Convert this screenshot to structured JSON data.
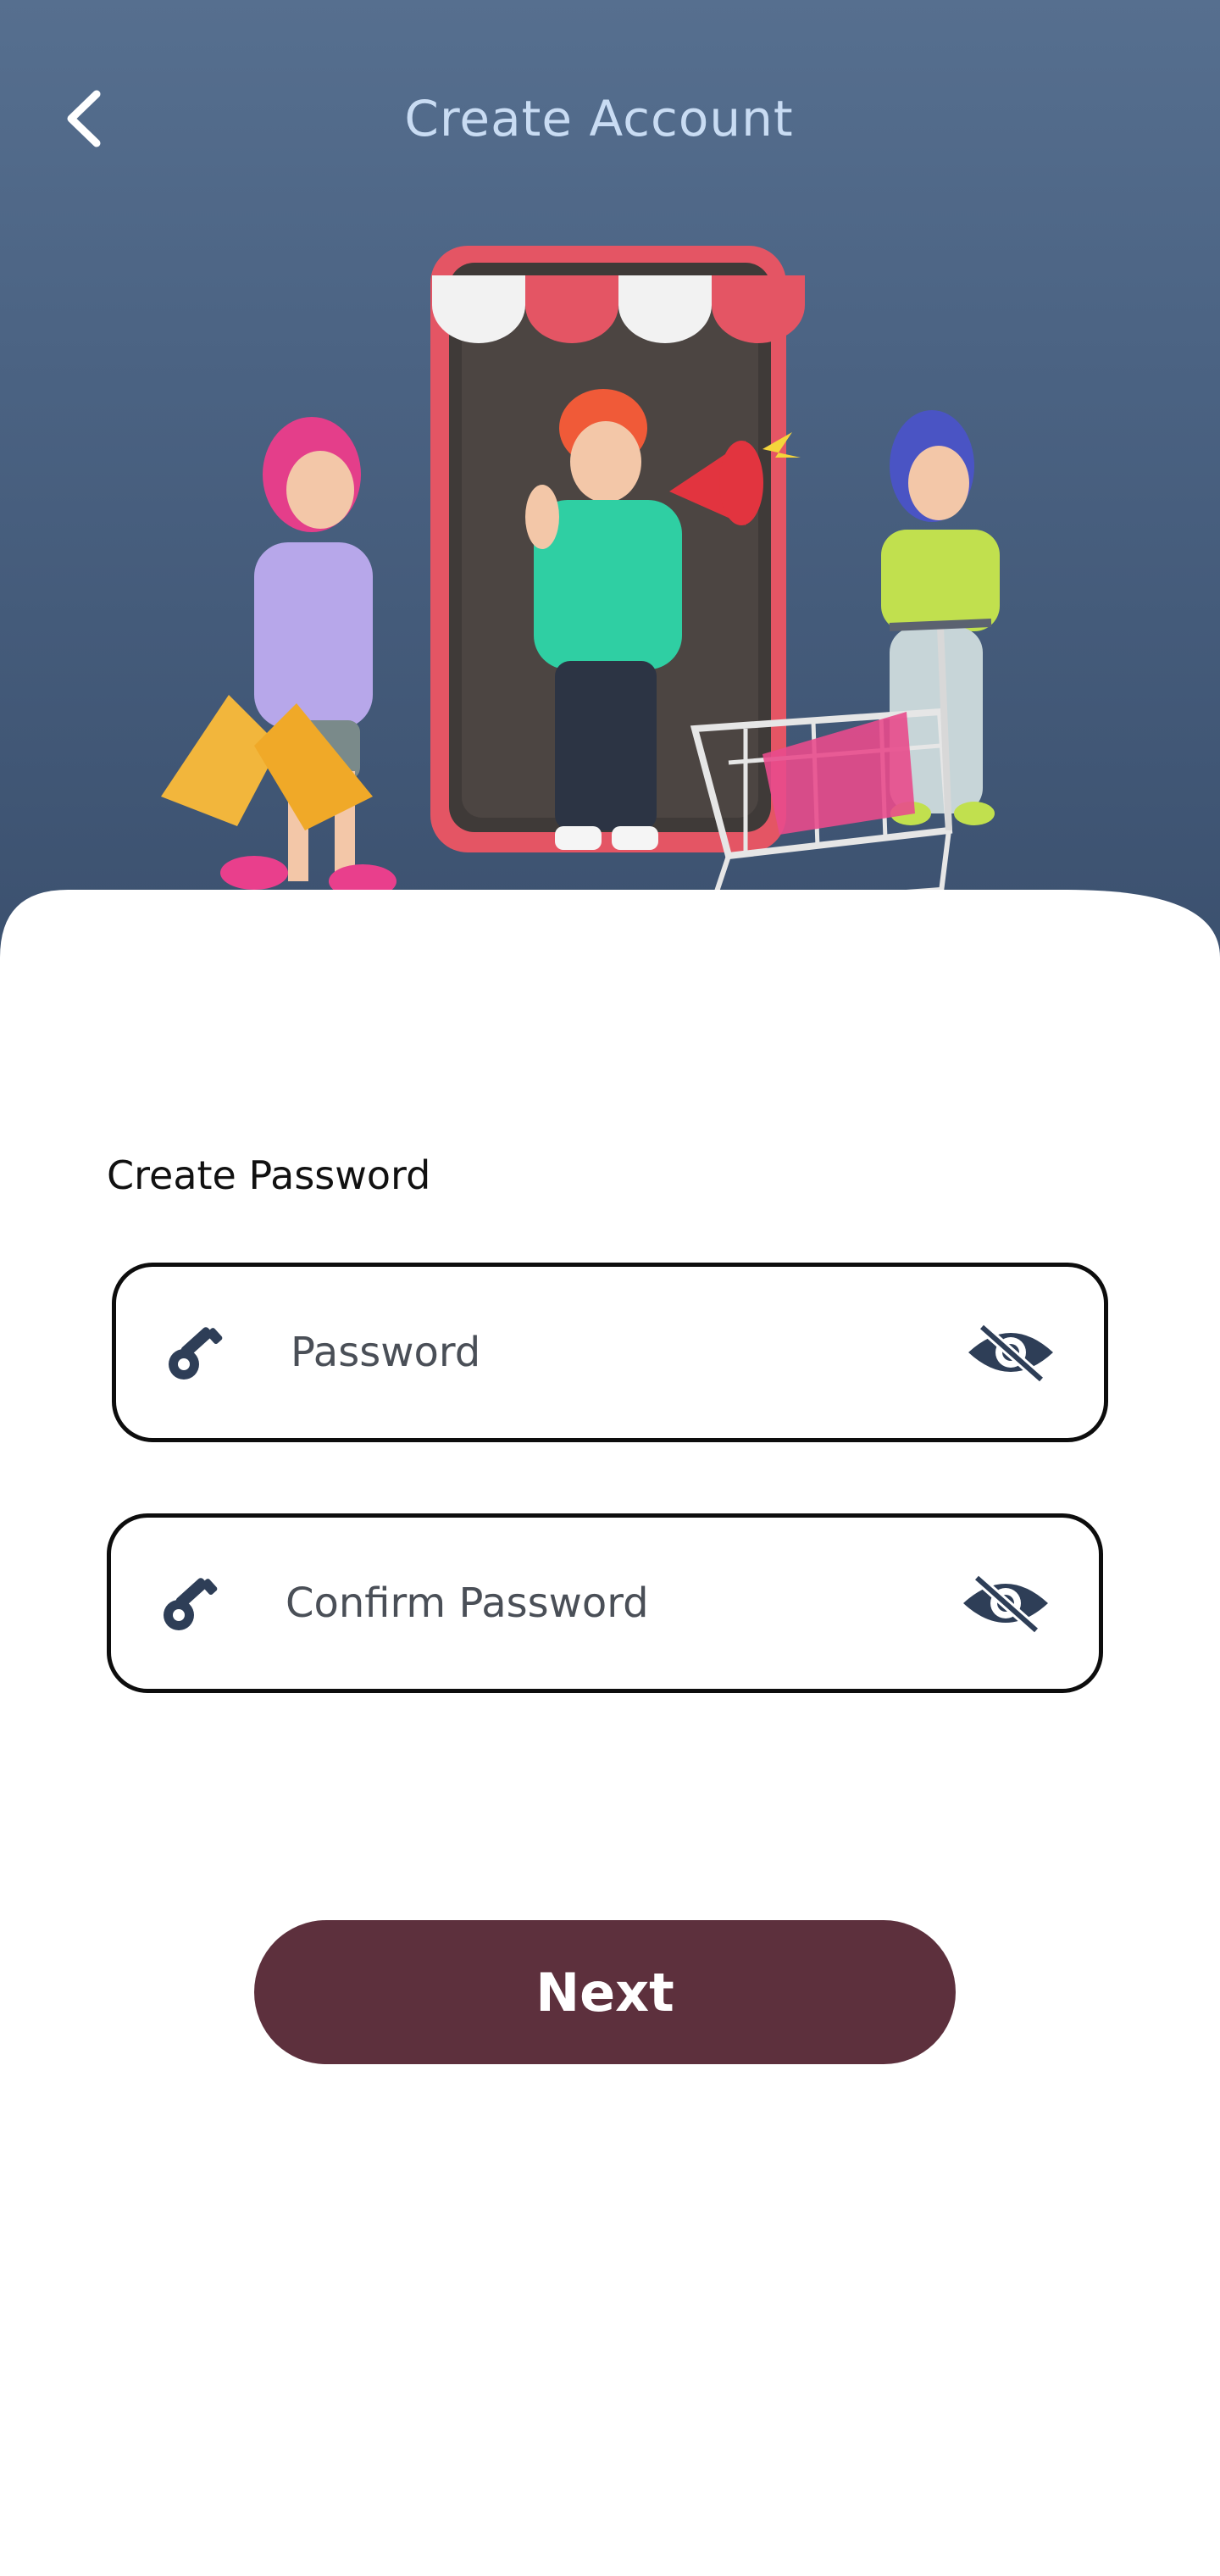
{
  "header": {
    "title": "Create Account",
    "back_icon": "chevron-left-icon",
    "background_color": "#4b6383",
    "title_color": "#c9dcf3"
  },
  "illustration": {
    "description_icon": "shopping-people-storefront-illustration"
  },
  "form": {
    "section_label": "Create Password",
    "password": {
      "placeholder": "Password",
      "value": "",
      "leading_icon": "key-icon",
      "trailing_icon": "eye-slash-icon"
    },
    "confirm_password": {
      "placeholder": "Confirm Password",
      "value": "",
      "leading_icon": "key-icon",
      "trailing_icon": "eye-slash-icon"
    }
  },
  "actions": {
    "next_label": "Next",
    "next_color": "#5d303d"
  },
  "colors": {
    "icon": "#2e3e57",
    "border": "#0d0d0d"
  }
}
